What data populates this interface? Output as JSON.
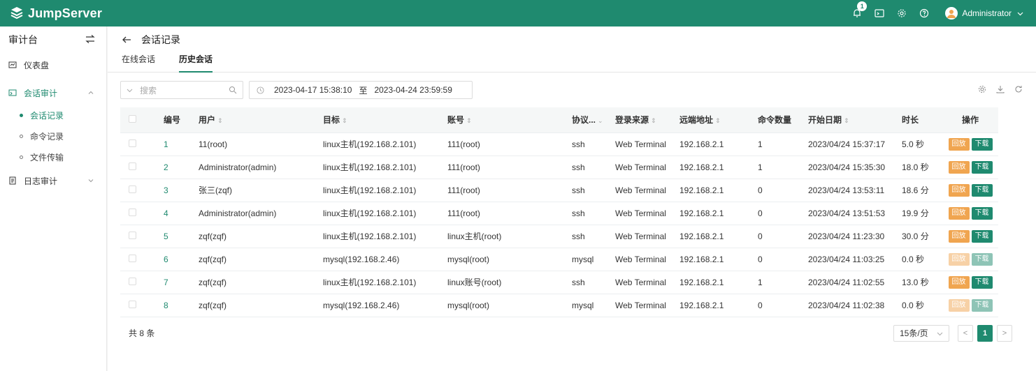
{
  "header": {
    "logo_text": "JumpServer",
    "notification_count": "1",
    "user_name": "Administrator",
    "colors": {
      "brand": "#1f8a6f",
      "play": "#f0a550"
    }
  },
  "sidebar": {
    "title": "审计台",
    "items": [
      {
        "label": "仪表盘",
        "icon": "dashboard-icon"
      },
      {
        "label": "会话审计",
        "icon": "session-audit-icon",
        "expanded": true
      },
      {
        "label": "日志审计",
        "icon": "log-audit-icon",
        "expanded": false
      }
    ],
    "sub_items": [
      {
        "label": "会话记录",
        "active": true
      },
      {
        "label": "命令记录",
        "active": false
      },
      {
        "label": "文件传输",
        "active": false
      }
    ]
  },
  "page": {
    "title": "会话记录",
    "tabs": [
      {
        "label": "在线会话",
        "active": false
      },
      {
        "label": "历史会话",
        "active": true
      }
    ]
  },
  "toolbar": {
    "search_placeholder": "搜索",
    "date_start": "2023-04-17 15:38:10",
    "date_sep": "至",
    "date_end": "2023-04-24 23:59:59"
  },
  "table": {
    "columns": [
      "编号",
      "用户",
      "目标",
      "账号",
      "协议...",
      "登录来源",
      "远端地址",
      "命令数量",
      "开始日期",
      "时长",
      "操作"
    ],
    "play_label": "回放",
    "download_label": "下载",
    "rows": [
      {
        "id": "1",
        "user": "11(root)",
        "target": "linux主机(192.168.2.101)",
        "account": "111(root)",
        "protocol": "ssh",
        "source": "Web Terminal",
        "remote": "192.168.2.1",
        "commands": "1",
        "start": "2023/04/24 15:37:17",
        "duration": "5.0 秒",
        "enabled": true
      },
      {
        "id": "2",
        "user": "Administrator(admin)",
        "target": "linux主机(192.168.2.101)",
        "account": "111(root)",
        "protocol": "ssh",
        "source": "Web Terminal",
        "remote": "192.168.2.1",
        "commands": "1",
        "start": "2023/04/24 15:35:30",
        "duration": "18.0 秒",
        "enabled": true
      },
      {
        "id": "3",
        "user": "张三(zqf)",
        "target": "linux主机(192.168.2.101)",
        "account": "111(root)",
        "protocol": "ssh",
        "source": "Web Terminal",
        "remote": "192.168.2.1",
        "commands": "0",
        "start": "2023/04/24 13:53:11",
        "duration": "18.6 分",
        "enabled": true
      },
      {
        "id": "4",
        "user": "Administrator(admin)",
        "target": "linux主机(192.168.2.101)",
        "account": "111(root)",
        "protocol": "ssh",
        "source": "Web Terminal",
        "remote": "192.168.2.1",
        "commands": "0",
        "start": "2023/04/24 13:51:53",
        "duration": "19.9 分",
        "enabled": true
      },
      {
        "id": "5",
        "user": "zqf(zqf)",
        "target": "linux主机(192.168.2.101)",
        "account": "linux主机(root)",
        "protocol": "ssh",
        "source": "Web Terminal",
        "remote": "192.168.2.1",
        "commands": "0",
        "start": "2023/04/24 11:23:30",
        "duration": "30.0 分",
        "enabled": true
      },
      {
        "id": "6",
        "user": "zqf(zqf)",
        "target": "mysql(192.168.2.46)",
        "account": "mysql(root)",
        "protocol": "mysql",
        "source": "Web Terminal",
        "remote": "192.168.2.1",
        "commands": "0",
        "start": "2023/04/24 11:03:25",
        "duration": "0.0 秒",
        "enabled": false
      },
      {
        "id": "7",
        "user": "zqf(zqf)",
        "target": "linux主机(192.168.2.101)",
        "account": "linux账号(root)",
        "protocol": "ssh",
        "source": "Web Terminal",
        "remote": "192.168.2.1",
        "commands": "1",
        "start": "2023/04/24 11:02:55",
        "duration": "13.0 秒",
        "enabled": true
      },
      {
        "id": "8",
        "user": "zqf(zqf)",
        "target": "mysql(192.168.2.46)",
        "account": "mysql(root)",
        "protocol": "mysql",
        "source": "Web Terminal",
        "remote": "192.168.2.1",
        "commands": "0",
        "start": "2023/04/24 11:02:38",
        "duration": "0.0 秒",
        "enabled": false
      }
    ]
  },
  "footer": {
    "total": "共 8 条",
    "page_size": "15条/页",
    "current_page": "1"
  }
}
